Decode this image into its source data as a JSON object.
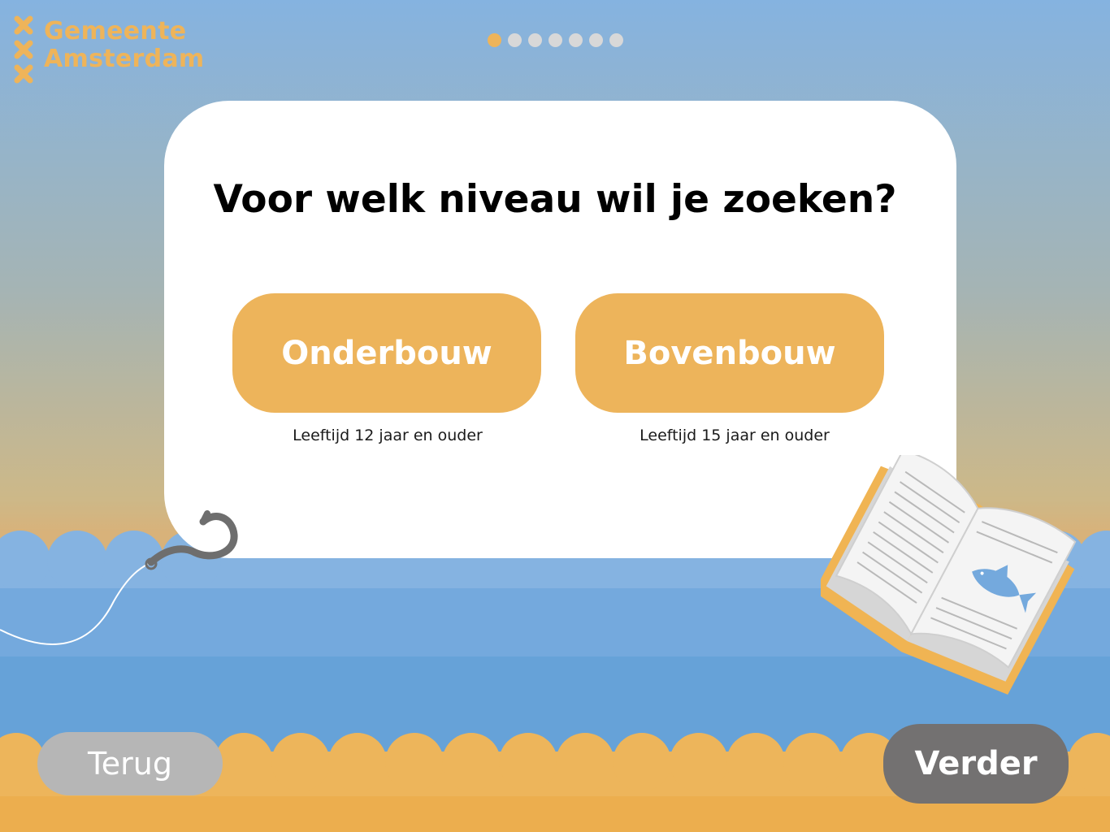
{
  "brand": {
    "line1": "Gemeente",
    "line2": "Amsterdam",
    "color": "#eeb45a"
  },
  "progress": {
    "total_steps": 7,
    "current_step": 1
  },
  "question": "Voor welk niveau wil je zoeken?",
  "options": [
    {
      "label": "Onderbouw",
      "sublabel": "Leeftijd 12 jaar en ouder"
    },
    {
      "label": "Bovenbouw",
      "sublabel": "Leeftijd 15 jaar en ouder"
    }
  ],
  "navigation": {
    "back_label": "Terug",
    "next_label": "Verder"
  },
  "colors": {
    "accent": "#edb45b",
    "water": "#66a2d8",
    "back_button": "#b6b6b6",
    "next_button": "#737171"
  },
  "icons": [
    "amsterdam-cross-icon",
    "fishing-hook-icon",
    "open-book-icon",
    "fish-icon"
  ]
}
